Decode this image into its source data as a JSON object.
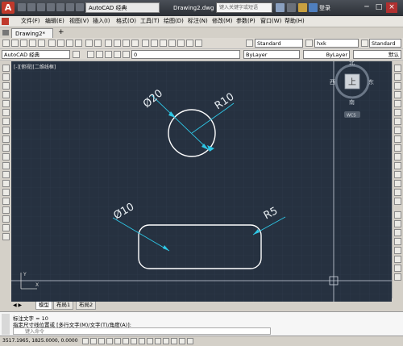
{
  "titlebar": {
    "workspace": "AutoCAD 经典",
    "document_title": "Drawing2.dwg",
    "search_placeholder": "键入关键字或短语",
    "login": "登录"
  },
  "menu": [
    "文件(F)",
    "编辑(E)",
    "视图(V)",
    "插入(I)",
    "格式(O)",
    "工具(T)",
    "绘图(D)",
    "标注(N)",
    "修改(M)",
    "参数(P)",
    "窗口(W)",
    "帮助(H)"
  ],
  "file_tab": "Drawing2*",
  "toolbar": {
    "workspace_combo": "AutoCAD 经典",
    "layer_combo": "0",
    "text_style": "Standard",
    "dim_style": "hxk",
    "table_style": "Standard",
    "color_combo": "ByLayer",
    "linetype_combo": "ByLayer",
    "lineweight_combo": "默认"
  },
  "viewport": {
    "label": "[-][俯视][二维线框]"
  },
  "viewcube": {
    "north": "北",
    "south": "南",
    "east": "东",
    "west": "西",
    "face": "上",
    "wcs": "WCS"
  },
  "dims": {
    "circle_diameter": "Ø20",
    "circle_radius": "R10",
    "slot_diameter": "Ø10",
    "slot_radius": "R5"
  },
  "layout_tabs": [
    "模型",
    "布局1",
    "布局2"
  ],
  "command": {
    "line1": "标注文字 = 10",
    "line2": "指定尺寸线位置或 [多行文字(M)/文字(T)/角度(A)]:",
    "prompt": "键入命令"
  },
  "status": {
    "coords": "3517.1965, 1825.0000, 0.0000"
  }
}
